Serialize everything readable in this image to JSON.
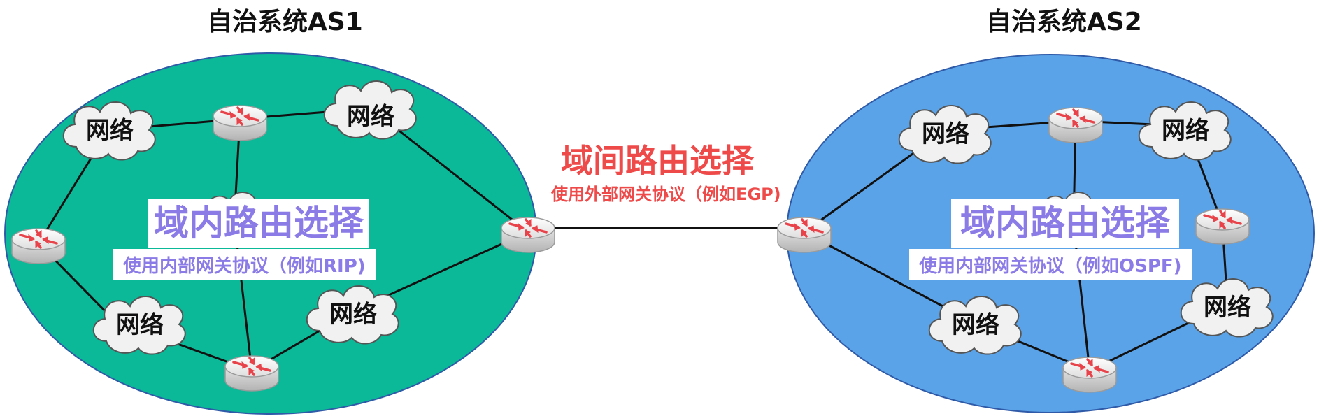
{
  "as1": {
    "title": "自治系统AS1",
    "intra_title": "域内路由选择",
    "intra_protocol": "使用内部网关协议（例如RIP)",
    "color": "#0bb897"
  },
  "as2": {
    "title": "自治系统AS2",
    "intra_title": "域内路由选择",
    "intra_protocol": "使用内部网关协议（例如OSPF)",
    "color": "#5ba3e8"
  },
  "inter": {
    "title": "域间路由选择",
    "protocol": "使用外部网关协议（例如EGP)",
    "color": "#ef4a4a"
  },
  "network_label": "网络",
  "icons": [
    "router-icon",
    "cloud-icon"
  ]
}
